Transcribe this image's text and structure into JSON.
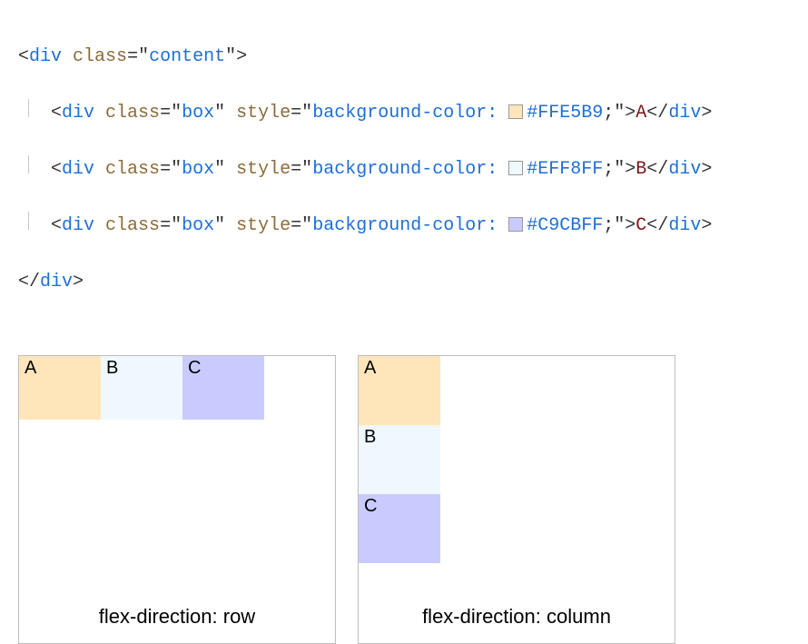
{
  "code": {
    "wrapper_tag": "div",
    "wrapper_class_attr": "class",
    "wrapper_class_val": "content",
    "child_tag": "div",
    "child_class_attr": "class",
    "child_class_val": "box",
    "style_attr": "style",
    "style_prop": "background-color:",
    "rows": [
      {
        "hex": "#FFE5B9",
        "letter": "A"
      },
      {
        "hex": "#EFF8FF",
        "letter": "B"
      },
      {
        "hex": "#C9CBFF",
        "letter": "C"
      }
    ]
  },
  "panels": {
    "left_caption": "flex-direction: row",
    "right_caption": "flex-direction: column",
    "boxes": [
      {
        "label": "A",
        "color": "#FFE5B9"
      },
      {
        "label": "B",
        "color": "#EFF8FF"
      },
      {
        "label": "C",
        "color": "#C9CBFF"
      }
    ]
  }
}
